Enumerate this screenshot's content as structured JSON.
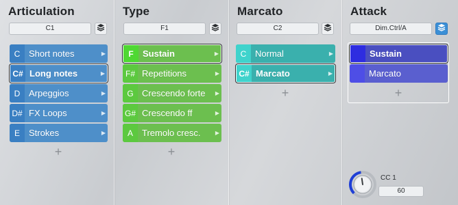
{
  "colors": {
    "articulation": "#4e8fc9",
    "articulation_key": "#3a7fc2",
    "type": "#6cbf4f",
    "type_key": "#4fd833",
    "marcato": "#3ab0ad",
    "marcato_key": "#3fd3cc",
    "attack": "#4a4fc0",
    "attack_key": "#2e2de0",
    "knob_accent": "#1f3fd6"
  },
  "columns": [
    {
      "title": "Articulation",
      "selector": "C1",
      "items": [
        {
          "key": "C",
          "label": "Short notes",
          "arrow": true
        },
        {
          "key": "C#",
          "label": "Long notes",
          "arrow": true,
          "selected": true
        },
        {
          "key": "D",
          "label": "Arpeggios",
          "arrow": true
        },
        {
          "key": "D#",
          "label": "FX Loops",
          "arrow": true
        },
        {
          "key": "E",
          "label": "Strokes",
          "arrow": true
        }
      ],
      "add_label": "+"
    },
    {
      "title": "Type",
      "selector": "F1",
      "items": [
        {
          "key": "F",
          "label": "Sustain",
          "arrow": true,
          "selected": true
        },
        {
          "key": "F#",
          "label": "Repetitions",
          "arrow": true
        },
        {
          "key": "G",
          "label": "Crescendo forte",
          "arrow": true
        },
        {
          "key": "G#",
          "label": "Crescendo ff",
          "arrow": true
        },
        {
          "key": "A",
          "label": "Tremolo cresc.",
          "arrow": true
        }
      ],
      "add_label": "+"
    },
    {
      "title": "Marcato",
      "selector": "C2",
      "items": [
        {
          "key": "C",
          "label": "Normal",
          "arrow": true
        },
        {
          "key": "C#",
          "label": "Marcato",
          "arrow": true,
          "selected": true
        }
      ],
      "add_label": "+"
    },
    {
      "title": "Attack",
      "selector": "Dim.Ctrl/A",
      "items": [
        {
          "key": "",
          "label": "Sustain",
          "arrow": false,
          "selected": true
        },
        {
          "key": "",
          "label": "Marcato",
          "arrow": false
        }
      ],
      "add_label": "+"
    }
  ],
  "cc": {
    "label": "CC 1",
    "value": "60",
    "knob_fraction": 0.47
  }
}
